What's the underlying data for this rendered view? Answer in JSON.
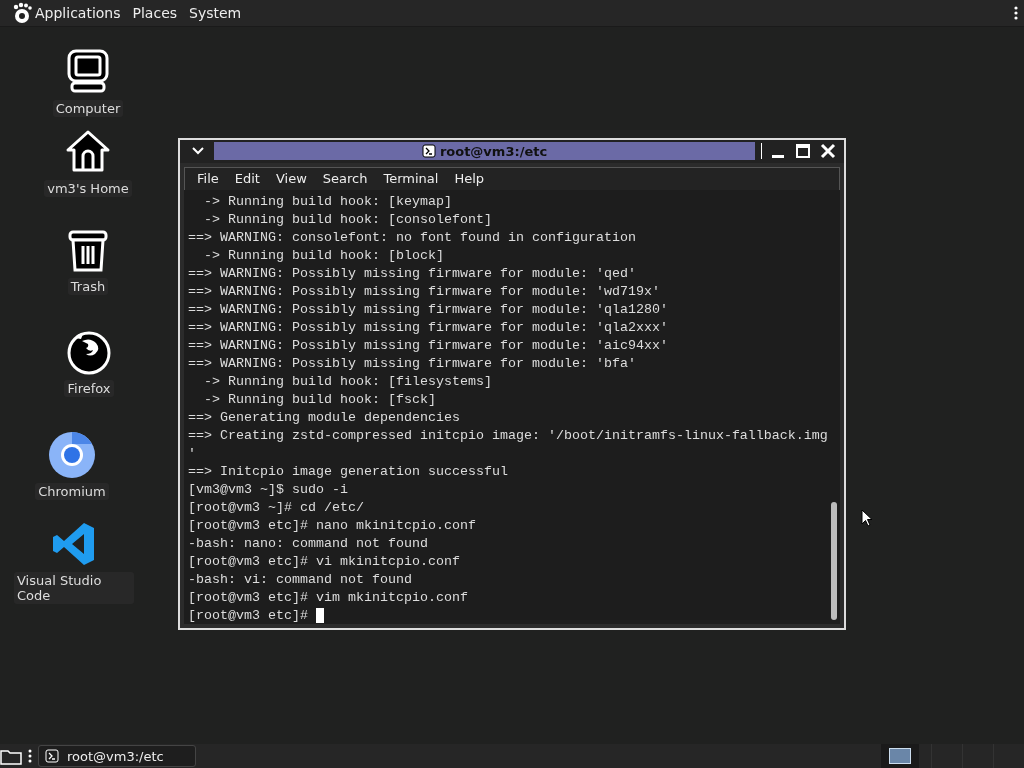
{
  "top_panel": {
    "menus": [
      "Applications",
      "Places",
      "System"
    ]
  },
  "desktop_icons": [
    {
      "kind": "computer",
      "label": "Computer"
    },
    {
      "kind": "home",
      "label": "vm3's Home"
    },
    {
      "kind": "trash",
      "label": "Trash"
    },
    {
      "kind": "firefox",
      "label": "Firefox"
    },
    {
      "kind": "chromium",
      "label": "Chromium"
    },
    {
      "kind": "vscode",
      "label": "Visual Studio Code"
    }
  ],
  "window": {
    "title": "root@vm3:/etc",
    "menu": [
      "File",
      "Edit",
      "View",
      "Search",
      "Terminal",
      "Help"
    ],
    "lines": [
      "  -> Running build hook: [keymap]",
      "  -> Running build hook: [consolefont]",
      "==> WARNING: consolefont: no font found in configuration",
      "  -> Running build hook: [block]",
      "==> WARNING: Possibly missing firmware for module: 'qed'",
      "==> WARNING: Possibly missing firmware for module: 'wd719x'",
      "==> WARNING: Possibly missing firmware for module: 'qla1280'",
      "==> WARNING: Possibly missing firmware for module: 'qla2xxx'",
      "==> WARNING: Possibly missing firmware for module: 'aic94xx'",
      "==> WARNING: Possibly missing firmware for module: 'bfa'",
      "  -> Running build hook: [filesystems]",
      "  -> Running build hook: [fsck]",
      "==> Generating module dependencies",
      "==> Creating zstd-compressed initcpio image: '/boot/initramfs-linux-fallback.img",
      "'",
      "==> Initcpio image generation successful",
      "[vm3@vm3 ~]$ sudo -i",
      "[root@vm3 ~]# cd /etc/",
      "[root@vm3 etc]# nano mkinitcpio.conf",
      "-bash: nano: command not found",
      "[root@vm3 etc]# vi mkinitcpio.conf",
      "-bash: vi: command not found",
      "[root@vm3 etc]# vim mkinitcpio.conf",
      "[root@vm3 etc]# "
    ],
    "cursor": true
  },
  "taskbar": {
    "tasks": [
      {
        "label": "root@vm3:/etc",
        "selected": false
      }
    ]
  }
}
